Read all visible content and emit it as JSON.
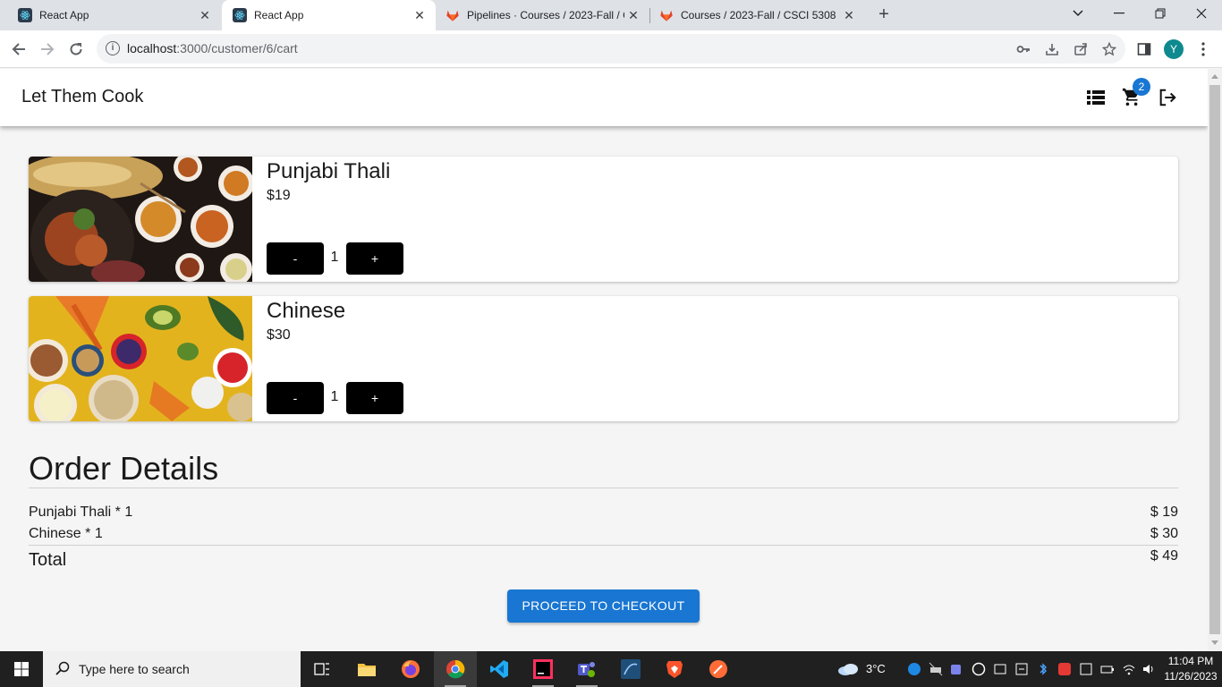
{
  "browser": {
    "tabs": [
      {
        "title": "React App",
        "icon": "react-icon",
        "active": false
      },
      {
        "title": "React App",
        "icon": "react-icon",
        "active": true
      },
      {
        "title": "Pipelines · Courses / 2023-Fall / C",
        "icon": "gitlab-icon",
        "active": false
      },
      {
        "title": "Courses / 2023-Fall / CSCI 5308",
        "icon": "gitlab-icon",
        "active": false
      }
    ],
    "url_host": "localhost",
    "url_path": ":3000/customer/6/cart",
    "profile_initial": "Y"
  },
  "app": {
    "brand": "Let Them Cook",
    "cart_count": "2",
    "cart_items": [
      {
        "name": "Punjabi Thali",
        "price": "$19",
        "minus": "-",
        "quantity": "1",
        "plus": "+"
      },
      {
        "name": "Chinese",
        "price": "$30",
        "minus": "-",
        "quantity": "1",
        "plus": "+"
      }
    ],
    "order_details": {
      "title": "Order Details",
      "lines": [
        {
          "label": "Punjabi Thali * 1",
          "amount": "$ 19"
        },
        {
          "label": "Chinese * 1",
          "amount": "$ 30"
        }
      ],
      "total_label": "Total",
      "total_amount": "$ 49"
    },
    "checkout_label": "PROCEED TO CHECKOUT"
  },
  "taskbar": {
    "search_placeholder": "Type here to search",
    "weather": "3°C",
    "time": "11:04 PM",
    "date": "11/26/2023"
  },
  "colors": {
    "primary": "#1976d2",
    "button_dark": "#000000",
    "page_bg": "#f5f5f5"
  }
}
